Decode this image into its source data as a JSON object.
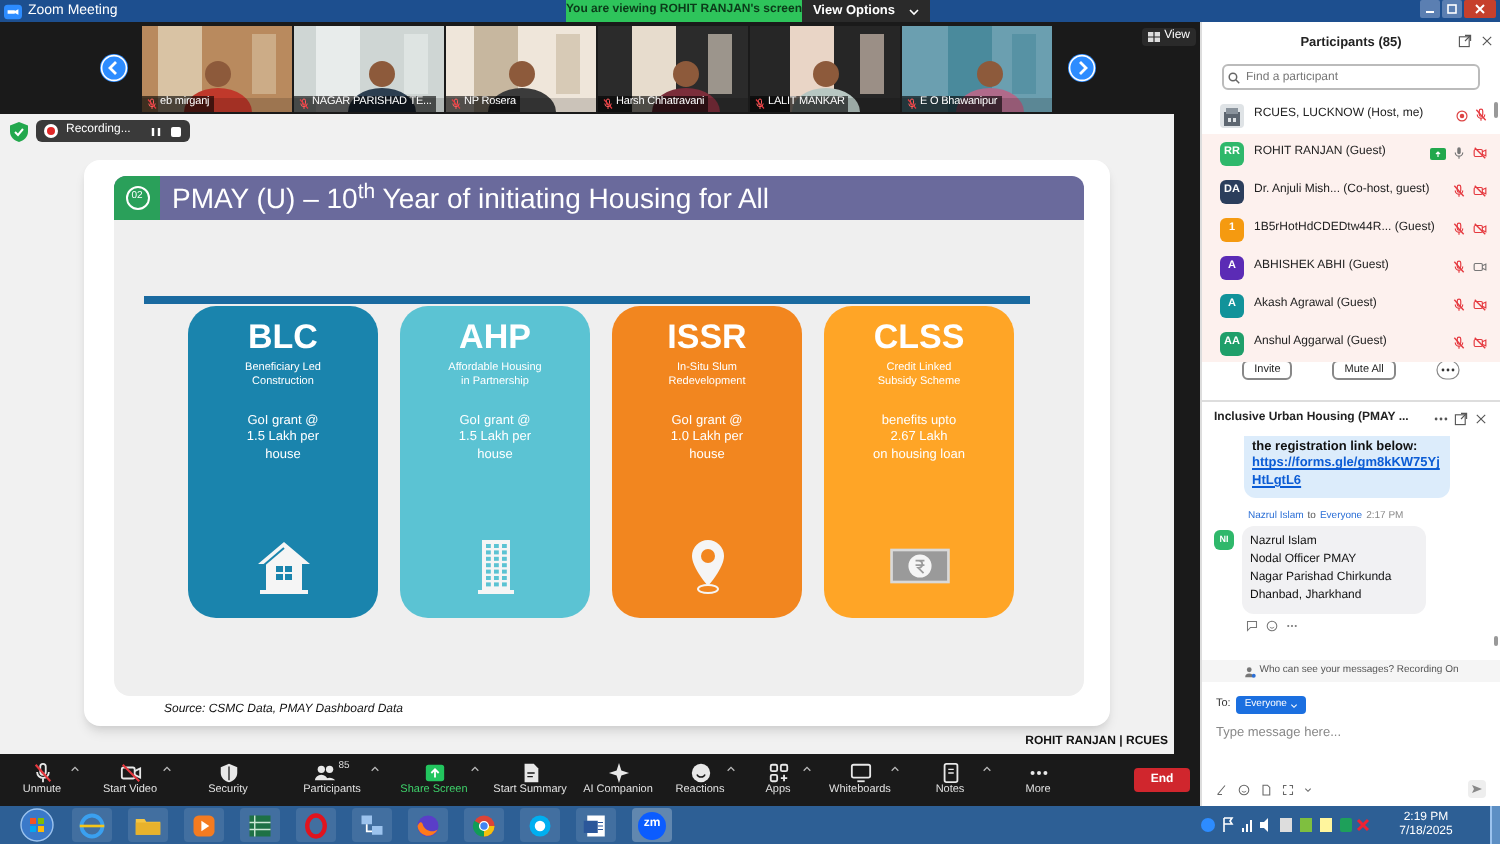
{
  "window": {
    "title": "Zoom Meeting",
    "banner": "You are viewing ROHIT RANJAN's screen",
    "view_options": "View Options"
  },
  "video_strip": {
    "view_button": "View",
    "tiles": [
      {
        "name": "eb mirganj",
        "muted": true
      },
      {
        "name": "NAGAR PARISHAD TE...",
        "muted": true
      },
      {
        "name": "NP Rosera",
        "muted": true
      },
      {
        "name": "Harsh Chhatravani",
        "muted": true
      },
      {
        "name": "LALIT MANKAR",
        "muted": true
      },
      {
        "name": "E O Bhawanipur",
        "muted": true
      }
    ]
  },
  "recording": {
    "label": "Recording..."
  },
  "slide": {
    "number": "02",
    "title": "PMAY (U) – 10$^{th}$ Year of initiating Housing for All",
    "cards": [
      {
        "code": "BLC",
        "subtitle": "Beneficiary Led\nConstruction",
        "benefit": "GoI grant @\n1.5 Lakh per\nhouse",
        "color": "#1a84ad"
      },
      {
        "code": "AHP",
        "subtitle": "Affordable Housing\nin Partnership",
        "benefit": "GoI grant @\n1.5 Lakh per\nhouse",
        "color": "#5bc3d3"
      },
      {
        "code": "ISSR",
        "subtitle": "In-Situ Slum\nRedevelopment",
        "benefit": "GoI grant @\n1.0 Lakh per\nhouse",
        "color": "#f2861f"
      },
      {
        "code": "CLSS",
        "subtitle": "Credit Linked\nSubsidy Scheme",
        "benefit": "benefits upto\n2.67 Lakh\non housing loan",
        "color": "#ffa526"
      }
    ],
    "source": "Source: CSMC Data, PMAY Dashboard Data"
  },
  "presenter_label": "ROHIT RANJAN | RCUES",
  "toolbar": {
    "items": [
      {
        "label": "Unmute",
        "caret": true
      },
      {
        "label": "Start Video",
        "caret": true
      },
      {
        "label": "Security",
        "caret": false
      },
      {
        "label": "Participants",
        "caret": true,
        "count": "85"
      },
      {
        "label": "Share Screen",
        "caret": true
      },
      {
        "label": "Start Summary",
        "caret": false
      },
      {
        "label": "AI Companion",
        "caret": false
      },
      {
        "label": "Reactions",
        "caret": true
      },
      {
        "label": "Apps",
        "caret": true
      },
      {
        "label": "Whiteboards",
        "caret": true
      },
      {
        "label": "Notes",
        "caret": true
      },
      {
        "label": "More",
        "caret": false
      }
    ],
    "end": "End"
  },
  "participants_panel": {
    "title": "Participants (85)",
    "search": {
      "placeholder": "Find a participant"
    },
    "participants": [
      {
        "name": "RCUES, LUCKNOW (Host, me)",
        "highlighted": false,
        "recording": true,
        "sharing": false,
        "muted": true
      },
      {
        "kind": "initials",
        "initials": "RR",
        "color": "#2fb86b",
        "name": "ROHIT RANJAN (Guest)",
        "highlighted": true,
        "recording": false,
        "sharing": true,
        "muted": false,
        "video_off": true
      },
      {
        "kind": "initials",
        "initials": "DA",
        "color": "#2b3e5c",
        "name": "Dr. Anjuli Mish... (Co-host, guest)",
        "highlighted": true,
        "recording": false,
        "sharing": false,
        "muted": true,
        "video_off": true
      },
      {
        "kind": "initials",
        "initials": "1",
        "color": "#f59a10",
        "name": "1B5rHotHdCDEDtw44R... (Guest)",
        "highlighted": true,
        "recording": false,
        "sharing": false,
        "muted": true,
        "video_off": true
      },
      {
        "kind": "initials",
        "initials": "A",
        "color": "#5b2bb5",
        "name": "ABHISHEK ABHI (Guest)",
        "highlighted": true,
        "recording": false,
        "sharing": false,
        "muted": true,
        "video_off": false
      },
      {
        "kind": "initials",
        "initials": "A",
        "color": "#12939a",
        "name": "Akash Agrawal (Guest)",
        "highlighted": true,
        "recording": false,
        "sharing": false,
        "muted": true,
        "video_off": true
      },
      {
        "kind": "initials",
        "initials": "AA",
        "color": "#1f9f6a",
        "name": "Anshul Aggarwal (Guest)",
        "highlighted": true,
        "recording": false,
        "sharing": false,
        "muted": true,
        "video_off": true
      }
    ],
    "buttons": [
      "Invite",
      "Mute All"
    ]
  },
  "chat": {
    "title": "Inclusive Urban Housing (PMAY ...",
    "messages": [
      {
        "kind": "sent",
        "text": "the registration link below:",
        "link": "https://forms.gle/gm8kKW75YjHtLgtL6"
      },
      {
        "kind": "received",
        "sender": "Nazrul Islam",
        "connector": "to",
        "recipient": "Everyone",
        "time": "2:17 PM",
        "initials": "NI",
        "color": "#2fb86b",
        "text": "Nazrul Islam\nNodal Officer PMAY\nNagar Parishad Chirkunda\nDhanbad, Jharkhand"
      }
    ],
    "privacy_note": "Who can see your messages? Recording On",
    "to_label": "To:",
    "recipient_button": "Everyone",
    "input": {
      "placeholder": "Type message here..."
    }
  },
  "taskbar": {
    "zoom_label": "zm",
    "time": "2:19 PM",
    "date": "7/18/2025"
  }
}
